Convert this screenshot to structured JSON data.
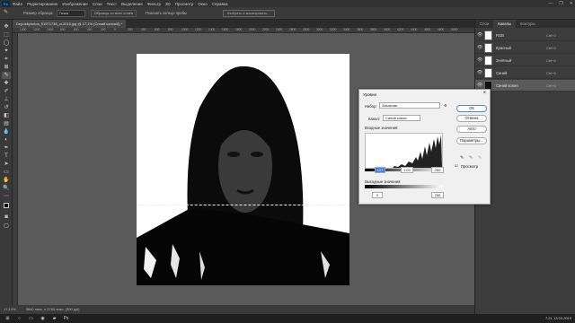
{
  "menubar": {
    "logo": "Ps",
    "items": [
      "Файл",
      "Редактирование",
      "Изображение",
      "Слои",
      "Текст",
      "Выделение",
      "Фильтр",
      "3D",
      "Просмотр",
      "Окно",
      "Справка"
    ],
    "win": [
      "—",
      "❐",
      "✕"
    ]
  },
  "options": {
    "tool_icon": "✎",
    "label_sample": "Размер образца:",
    "sample_value": "Точка",
    "btn1": "Образцы со всех слоёв",
    "chk": "Показать кольцо пробы",
    "btn2": "Выбрать и маскировать..."
  },
  "document": {
    "tab_title": "Depositphotos_91971738_xl-2015.jpg @ 17,1% (Синий копия/8) *",
    "ruler": [
      "1400",
      "1200",
      "1000",
      "800",
      "600",
      "400",
      "200",
      "0",
      "200",
      "400",
      "600",
      "800",
      "1000",
      "1200",
      "1400",
      "1600",
      "1800",
      "2000",
      "2200",
      "2400",
      "2600",
      "2800",
      "3000",
      "3200",
      "3400",
      "3600",
      "3800",
      "4000",
      "4200",
      "4400",
      "4600",
      "4800",
      "5000"
    ]
  },
  "status": {
    "zoom": "17,14%",
    "size": "3840 пикс. x 2760 пикс. (300 ppi)"
  },
  "panel": {
    "tabs": [
      "Слои",
      "Каналы",
      "Контуры"
    ],
    "active_tab": 1,
    "channels": [
      {
        "name": "RGB",
        "shortcut": "Ctrl+2"
      },
      {
        "name": "Красный",
        "shortcut": "Ctrl+3"
      },
      {
        "name": "Зелёный",
        "shortcut": "Ctrl+4"
      },
      {
        "name": "Синий",
        "shortcut": "Ctrl+5"
      },
      {
        "name": "Синий копия",
        "shortcut": "Ctrl+6"
      }
    ]
  },
  "levels": {
    "title": "Уровни",
    "preset_label": "Набор:",
    "preset_value": "Заказная",
    "channel_label": "Канал:",
    "channel_value": "Синий копия",
    "input_label": "Входные значения:",
    "input_values": [
      "127",
      "1,00",
      "250"
    ],
    "output_label": "Выходные значения:",
    "output_values": [
      "0",
      "255"
    ],
    "btn_ok": "ОК",
    "btn_cancel": "Отмена",
    "btn_auto": "Авто",
    "btn_params": "Параметры...",
    "preview_label": "Просмотр",
    "preview_checked": true,
    "gear": "⚙"
  },
  "taskbar": {
    "time": "7:21",
    "date": "13.03.2019"
  }
}
